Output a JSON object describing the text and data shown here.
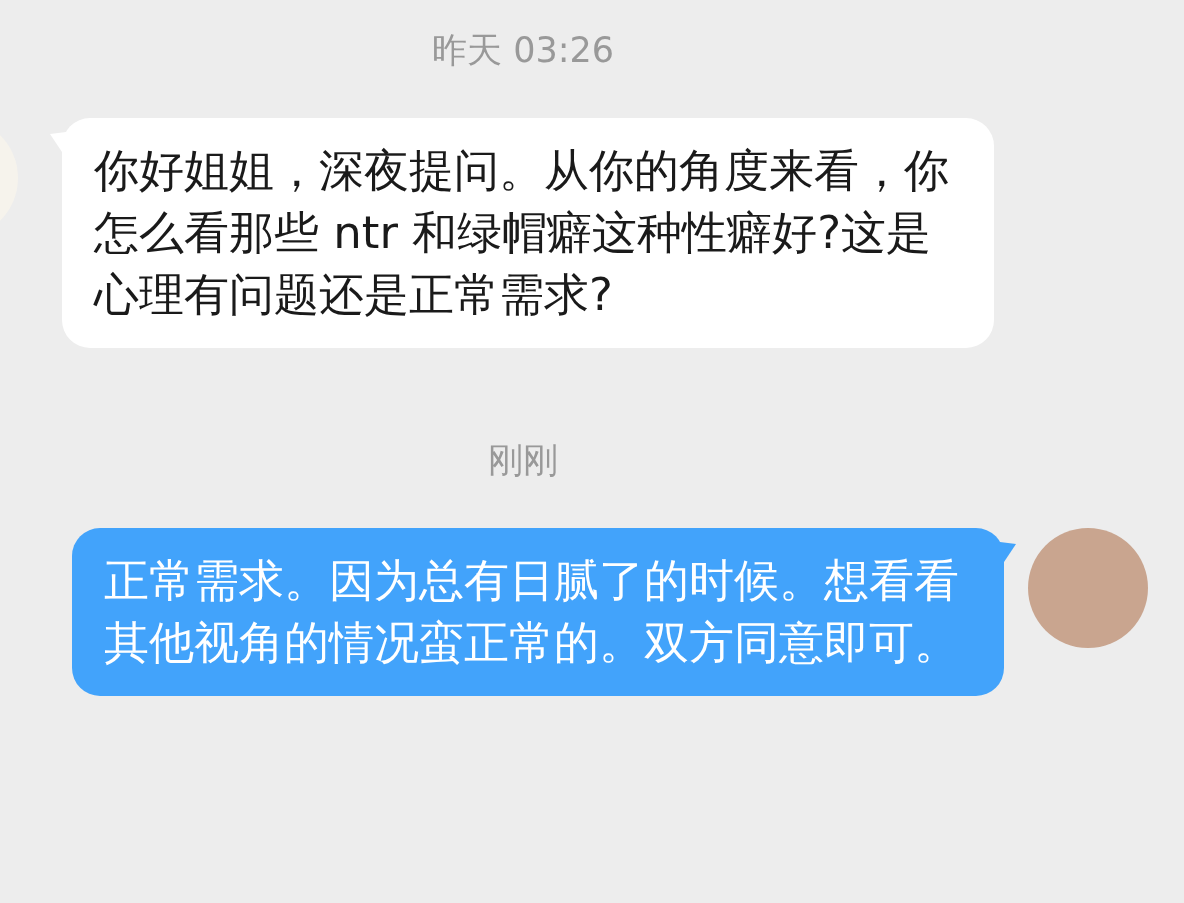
{
  "messages": [
    {
      "kind": "time",
      "text": "昨天 03:26"
    },
    {
      "kind": "received",
      "text": "你好姐姐，深夜提问。从你的角度来看，你怎么看那些 ntr 和绿帽癖这种性癖好?这是心理有问题还是正常需求?"
    },
    {
      "kind": "time",
      "text": "刚刚"
    },
    {
      "kind": "sent",
      "text": "正常需求。因为总有日腻了的时候。想看看其他视角的情况蛮正常的。双方同意即可。"
    }
  ]
}
